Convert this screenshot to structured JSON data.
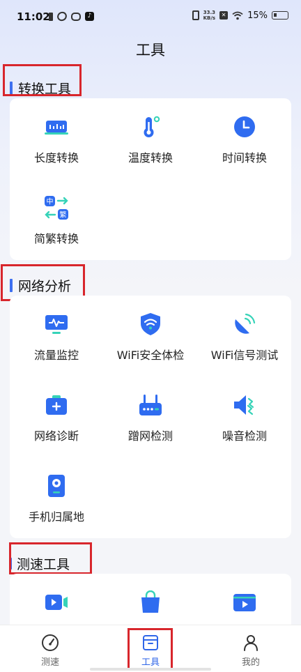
{
  "status_bar": {
    "time": "11:02",
    "net_speed_value": "33.3",
    "net_speed_unit": "KB/s",
    "battery_percent": "15%"
  },
  "page": {
    "title": "工具"
  },
  "sections": [
    {
      "title": "转换工具",
      "items": [
        {
          "label": "长度转换",
          "icon": "ruler-icon"
        },
        {
          "label": "温度转换",
          "icon": "thermometer-icon"
        },
        {
          "label": "时间转换",
          "icon": "clock-icon"
        },
        {
          "label": "简繁转换",
          "icon": "chinese-convert-icon",
          "glyph_a": "中",
          "glyph_b": "繁"
        }
      ]
    },
    {
      "title": "网络分析",
      "items": [
        {
          "label": "流量监控",
          "icon": "monitor-chart-icon"
        },
        {
          "label": "WiFi安全体检",
          "icon": "wifi-shield-icon"
        },
        {
          "label": "WiFi信号测试",
          "icon": "satellite-dish-icon"
        },
        {
          "label": "网络诊断",
          "icon": "medical-kit-icon"
        },
        {
          "label": "蹭网检测",
          "icon": "router-icon"
        },
        {
          "label": "噪音检测",
          "icon": "speaker-noise-icon"
        },
        {
          "label": "手机归属地",
          "icon": "phone-location-icon"
        }
      ]
    },
    {
      "title": "测速工具",
      "items": [
        {
          "label": "",
          "icon": "video-camera-icon"
        },
        {
          "label": "",
          "icon": "shopping-bag-icon"
        },
        {
          "label": "",
          "icon": "video-play-icon"
        }
      ]
    }
  ],
  "bottom_nav": [
    {
      "label": "测速",
      "icon": "speedometer-icon",
      "active": false
    },
    {
      "label": "工具",
      "icon": "toolbox-icon",
      "active": true
    },
    {
      "label": "我的",
      "icon": "person-icon",
      "active": false
    }
  ],
  "colors": {
    "accent": "#2f66e8",
    "icon_blue": "#2f6cf0",
    "icon_teal": "#36d3b8",
    "highlight_red": "#d8262c"
  }
}
